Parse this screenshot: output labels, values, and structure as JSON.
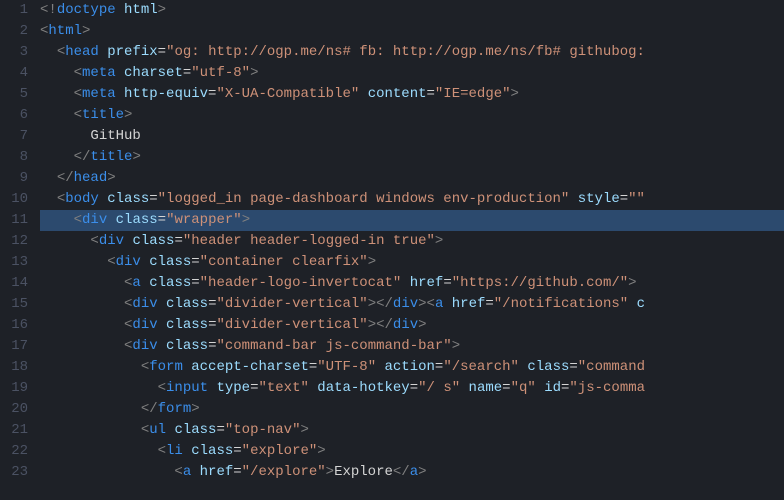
{
  "lines": [
    {
      "num": "1",
      "indent": 0,
      "hl": false,
      "tokens": [
        [
          "bracket",
          "<!"
        ],
        [
          "tag",
          "doctype"
        ],
        [
          "txt",
          " "
        ],
        [
          "attr",
          "html"
        ],
        [
          "bracket",
          ">"
        ]
      ]
    },
    {
      "num": "2",
      "indent": 0,
      "hl": false,
      "tokens": [
        [
          "bracket",
          "<"
        ],
        [
          "tag",
          "html"
        ],
        [
          "bracket",
          ">"
        ]
      ]
    },
    {
      "num": "3",
      "indent": 1,
      "hl": false,
      "tokens": [
        [
          "bracket",
          "<"
        ],
        [
          "tag",
          "head"
        ],
        [
          "txt",
          " "
        ],
        [
          "attr",
          "prefix"
        ],
        [
          "eq",
          "="
        ],
        [
          "str",
          "\"og: http://ogp.me/ns# fb: http://ogp.me/ns/fb# githubog:"
        ]
      ]
    },
    {
      "num": "4",
      "indent": 2,
      "hl": false,
      "tokens": [
        [
          "bracket",
          "<"
        ],
        [
          "tag",
          "meta"
        ],
        [
          "txt",
          " "
        ],
        [
          "attr",
          "charset"
        ],
        [
          "eq",
          "="
        ],
        [
          "str",
          "\"utf-8\""
        ],
        [
          "bracket",
          ">"
        ]
      ]
    },
    {
      "num": "5",
      "indent": 2,
      "hl": false,
      "tokens": [
        [
          "bracket",
          "<"
        ],
        [
          "tag",
          "meta"
        ],
        [
          "txt",
          " "
        ],
        [
          "attr",
          "http-equiv"
        ],
        [
          "eq",
          "="
        ],
        [
          "str",
          "\"X-UA-Compatible\""
        ],
        [
          "txt",
          " "
        ],
        [
          "attr",
          "content"
        ],
        [
          "eq",
          "="
        ],
        [
          "str",
          "\"IE=edge\""
        ],
        [
          "bracket",
          ">"
        ]
      ]
    },
    {
      "num": "6",
      "indent": 2,
      "hl": false,
      "tokens": [
        [
          "bracket",
          "<"
        ],
        [
          "tag",
          "title"
        ],
        [
          "bracket",
          ">"
        ]
      ]
    },
    {
      "num": "7",
      "indent": 3,
      "hl": false,
      "tokens": [
        [
          "txt",
          "GitHub"
        ]
      ]
    },
    {
      "num": "8",
      "indent": 2,
      "hl": false,
      "tokens": [
        [
          "bracket",
          "</"
        ],
        [
          "tag",
          "title"
        ],
        [
          "bracket",
          ">"
        ]
      ]
    },
    {
      "num": "9",
      "indent": 1,
      "hl": false,
      "tokens": [
        [
          "bracket",
          "</"
        ],
        [
          "tag",
          "head"
        ],
        [
          "bracket",
          ">"
        ]
      ]
    },
    {
      "num": "10",
      "indent": 1,
      "hl": false,
      "tokens": [
        [
          "bracket",
          "<"
        ],
        [
          "tag",
          "body"
        ],
        [
          "txt",
          " "
        ],
        [
          "attr",
          "class"
        ],
        [
          "eq",
          "="
        ],
        [
          "str",
          "\"logged_in page-dashboard windows env-production\""
        ],
        [
          "txt",
          " "
        ],
        [
          "attr",
          "style"
        ],
        [
          "eq",
          "="
        ],
        [
          "str",
          "\"\""
        ]
      ]
    },
    {
      "num": "11",
      "indent": 2,
      "hl": true,
      "tokens": [
        [
          "bracket",
          "<"
        ],
        [
          "tag",
          "div"
        ],
        [
          "txt",
          " "
        ],
        [
          "attr",
          "class"
        ],
        [
          "eq",
          "="
        ],
        [
          "str",
          "\"wrapper\""
        ],
        [
          "bracket",
          ">"
        ]
      ]
    },
    {
      "num": "12",
      "indent": 3,
      "hl": false,
      "tokens": [
        [
          "bracket",
          "<"
        ],
        [
          "tag",
          "div"
        ],
        [
          "txt",
          " "
        ],
        [
          "attr",
          "class"
        ],
        [
          "eq",
          "="
        ],
        [
          "str",
          "\"header header-logged-in true\""
        ],
        [
          "bracket",
          ">"
        ]
      ]
    },
    {
      "num": "13",
      "indent": 4,
      "hl": false,
      "tokens": [
        [
          "bracket",
          "<"
        ],
        [
          "tag",
          "div"
        ],
        [
          "txt",
          " "
        ],
        [
          "attr",
          "class"
        ],
        [
          "eq",
          "="
        ],
        [
          "str",
          "\"container clearfix\""
        ],
        [
          "bracket",
          ">"
        ]
      ]
    },
    {
      "num": "14",
      "indent": 5,
      "hl": false,
      "tokens": [
        [
          "bracket",
          "<"
        ],
        [
          "tag",
          "a"
        ],
        [
          "txt",
          " "
        ],
        [
          "attr",
          "class"
        ],
        [
          "eq",
          "="
        ],
        [
          "str",
          "\"header-logo-invertocat\""
        ],
        [
          "txt",
          " "
        ],
        [
          "attr",
          "href"
        ],
        [
          "eq",
          "="
        ],
        [
          "str",
          "\"https://github.com/\""
        ],
        [
          "bracket",
          ">"
        ]
      ]
    },
    {
      "num": "15",
      "indent": 5,
      "hl": false,
      "tokens": [
        [
          "bracket",
          "<"
        ],
        [
          "tag",
          "div"
        ],
        [
          "txt",
          " "
        ],
        [
          "attr",
          "class"
        ],
        [
          "eq",
          "="
        ],
        [
          "str",
          "\"divider-vertical\""
        ],
        [
          "bracket",
          ">"
        ],
        [
          "bracket",
          "</"
        ],
        [
          "tag",
          "div"
        ],
        [
          "bracket",
          ">"
        ],
        [
          "bracket",
          "<"
        ],
        [
          "tag",
          "a"
        ],
        [
          "txt",
          " "
        ],
        [
          "attr",
          "href"
        ],
        [
          "eq",
          "="
        ],
        [
          "str",
          "\"/notifications\""
        ],
        [
          "txt",
          " "
        ],
        [
          "attr",
          "c"
        ]
      ]
    },
    {
      "num": "16",
      "indent": 5,
      "hl": false,
      "tokens": [
        [
          "bracket",
          "<"
        ],
        [
          "tag",
          "div"
        ],
        [
          "txt",
          " "
        ],
        [
          "attr",
          "class"
        ],
        [
          "eq",
          "="
        ],
        [
          "str",
          "\"divider-vertical\""
        ],
        [
          "bracket",
          ">"
        ],
        [
          "bracket",
          "</"
        ],
        [
          "tag",
          "div"
        ],
        [
          "bracket",
          ">"
        ]
      ]
    },
    {
      "num": "17",
      "indent": 5,
      "hl": false,
      "tokens": [
        [
          "bracket",
          "<"
        ],
        [
          "tag",
          "div"
        ],
        [
          "txt",
          " "
        ],
        [
          "attr",
          "class"
        ],
        [
          "eq",
          "="
        ],
        [
          "str",
          "\"command-bar js-command-bar\""
        ],
        [
          "bracket",
          ">"
        ]
      ]
    },
    {
      "num": "18",
      "indent": 6,
      "hl": false,
      "tokens": [
        [
          "bracket",
          "<"
        ],
        [
          "tag",
          "form"
        ],
        [
          "txt",
          " "
        ],
        [
          "attr",
          "accept-charset"
        ],
        [
          "eq",
          "="
        ],
        [
          "str",
          "\"UTF-8\""
        ],
        [
          "txt",
          " "
        ],
        [
          "attr",
          "action"
        ],
        [
          "eq",
          "="
        ],
        [
          "str",
          "\"/search\""
        ],
        [
          "txt",
          " "
        ],
        [
          "attr",
          "class"
        ],
        [
          "eq",
          "="
        ],
        [
          "str",
          "\"command"
        ]
      ]
    },
    {
      "num": "19",
      "indent": 7,
      "hl": false,
      "tokens": [
        [
          "bracket",
          "<"
        ],
        [
          "tag",
          "input"
        ],
        [
          "txt",
          " "
        ],
        [
          "attr",
          "type"
        ],
        [
          "eq",
          "="
        ],
        [
          "str",
          "\"text\""
        ],
        [
          "txt",
          " "
        ],
        [
          "attr",
          "data-hotkey"
        ],
        [
          "eq",
          "="
        ],
        [
          "str",
          "\"/ s\""
        ],
        [
          "txt",
          " "
        ],
        [
          "attr",
          "name"
        ],
        [
          "eq",
          "="
        ],
        [
          "str",
          "\"q\""
        ],
        [
          "txt",
          " "
        ],
        [
          "attr",
          "id"
        ],
        [
          "eq",
          "="
        ],
        [
          "str",
          "\"js-comma"
        ]
      ]
    },
    {
      "num": "20",
      "indent": 6,
      "hl": false,
      "tokens": [
        [
          "bracket",
          "</"
        ],
        [
          "tag",
          "form"
        ],
        [
          "bracket",
          ">"
        ]
      ]
    },
    {
      "num": "21",
      "indent": 6,
      "hl": false,
      "tokens": [
        [
          "bracket",
          "<"
        ],
        [
          "tag",
          "ul"
        ],
        [
          "txt",
          " "
        ],
        [
          "attr",
          "class"
        ],
        [
          "eq",
          "="
        ],
        [
          "str",
          "\"top-nav\""
        ],
        [
          "bracket",
          ">"
        ]
      ]
    },
    {
      "num": "22",
      "indent": 7,
      "hl": false,
      "tokens": [
        [
          "bracket",
          "<"
        ],
        [
          "tag",
          "li"
        ],
        [
          "txt",
          " "
        ],
        [
          "attr",
          "class"
        ],
        [
          "eq",
          "="
        ],
        [
          "str",
          "\"explore\""
        ],
        [
          "bracket",
          ">"
        ]
      ]
    },
    {
      "num": "23",
      "indent": 8,
      "hl": false,
      "tokens": [
        [
          "bracket",
          "<"
        ],
        [
          "tag",
          "a"
        ],
        [
          "txt",
          " "
        ],
        [
          "attr",
          "href"
        ],
        [
          "eq",
          "="
        ],
        [
          "str",
          "\"/explore\""
        ],
        [
          "bracket",
          ">"
        ],
        [
          "txt",
          "Explore"
        ],
        [
          "bracket",
          "</"
        ],
        [
          "tag",
          "a"
        ],
        [
          "bracket",
          ">"
        ]
      ]
    }
  ],
  "indentUnit": "  "
}
